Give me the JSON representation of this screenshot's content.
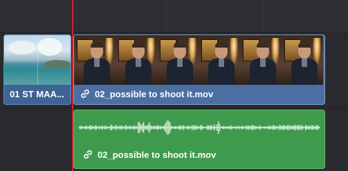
{
  "timeline": {
    "video_track": {
      "clips": [
        {
          "label": "01 ST MAA..."
        },
        {
          "label": "02_possible to shoot it.mov"
        }
      ]
    },
    "audio_track": {
      "clips": [
        {
          "label": "02_possible to shoot it.mov"
        }
      ]
    }
  },
  "colors": {
    "video_clip": "#4b6fa3",
    "audio_clip": "#3f9a4e",
    "playhead": "#c8272d",
    "background": "#2b2b2f"
  },
  "icons": {
    "clip_link": "link-icon"
  }
}
